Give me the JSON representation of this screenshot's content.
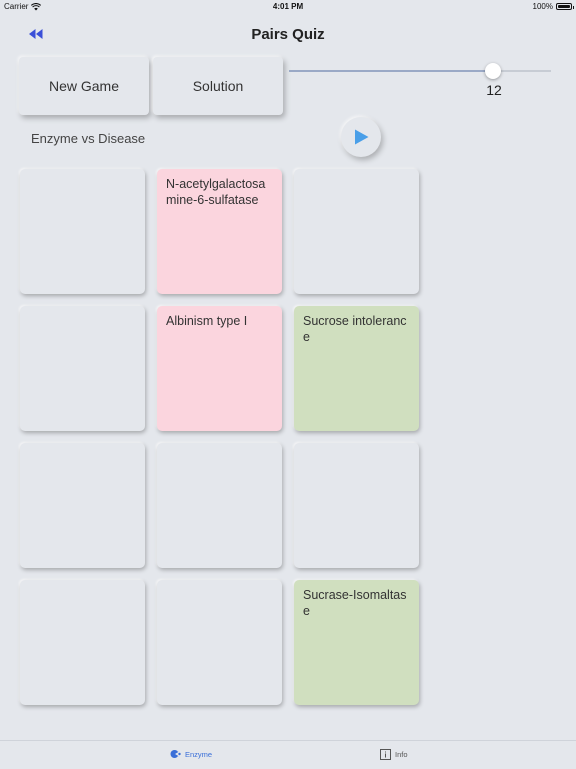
{
  "status_bar": {
    "carrier": "Carrier",
    "time": "4:01 PM",
    "battery": "100%"
  },
  "nav": {
    "title": "Pairs Quiz",
    "back_icon": "rewind-icon"
  },
  "controls": {
    "new_game_label": "New Game",
    "solution_label": "Solution",
    "slider": {
      "value": "12",
      "fraction": 0.78
    }
  },
  "quiz": {
    "label": "Enzyme vs Disease"
  },
  "cards": [
    {
      "text": "",
      "color": "#e4e7ec"
    },
    {
      "text": "N-acetylgalactosamine-6-sulfatase",
      "color": "#fbd5de"
    },
    {
      "text": "",
      "color": "#e4e7ec"
    },
    {
      "text": "",
      "color": "#e4e7ec"
    },
    {
      "text": "Albinism type I",
      "color": "#fbd5de"
    },
    {
      "text": "Sucrose intolerance",
      "color": "#d0dfbf"
    },
    {
      "text": "",
      "color": "#e4e7ec"
    },
    {
      "text": "",
      "color": "#e4e7ec"
    },
    {
      "text": "",
      "color": "#e4e7ec"
    },
    {
      "text": "",
      "color": "#e4e7ec"
    },
    {
      "text": "",
      "color": "#e4e7ec"
    },
    {
      "text": "Sucrase-Isomaltase",
      "color": "#d0dfbf"
    }
  ],
  "tabs": [
    {
      "label": "Enzyme",
      "icon": "enzyme-icon",
      "active": true
    },
    {
      "label": "Info",
      "icon": "info-icon",
      "active": false
    }
  ],
  "colors": {
    "accent": "#3a6fd8",
    "play": "#4a9fe8",
    "pink": "#fbd5de",
    "green": "#d0dfbf"
  }
}
